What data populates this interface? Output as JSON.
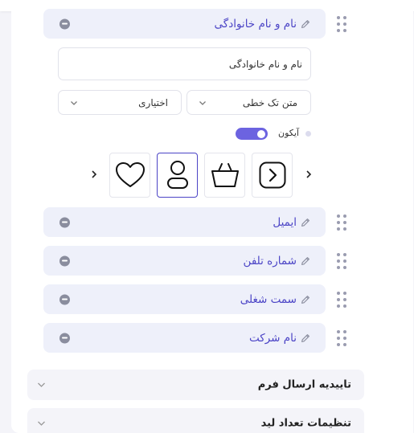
{
  "fields": [
    {
      "label": "نام و نام خانوادگی",
      "expanded": true
    },
    {
      "label": "ایمیل"
    },
    {
      "label": "شماره تلفن"
    },
    {
      "label": "سمت شغلی"
    },
    {
      "label": "نام شرکت"
    }
  ],
  "editor": {
    "placeholder_value": "نام و نام خانوادگی",
    "type_select": "متن تک خطی",
    "required_select": "اختیاری",
    "icon_toggle_label": "آیکون",
    "icon_toggle_on": true,
    "icons": [
      "chevron-right-square-icon",
      "basket-icon",
      "user-icon",
      "heart-icon"
    ],
    "selected_icon": "user-icon"
  },
  "sections": [
    {
      "title": "تاییدیه ارسال فرم"
    },
    {
      "title": "تنظیمات تعداد لید"
    }
  ],
  "colors": {
    "accent": "#4b44c6",
    "toggle": "#6c63e0",
    "row_bg": "#eef0fa",
    "section_bg": "#f4f4f9"
  }
}
